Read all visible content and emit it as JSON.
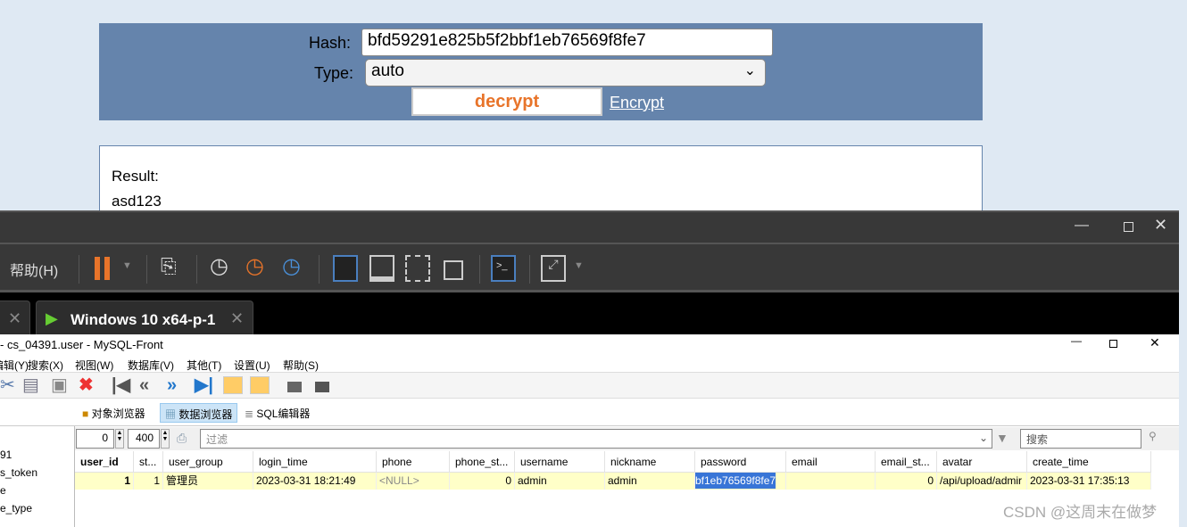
{
  "hash_form": {
    "hash_label": "Hash:",
    "hash_value": "bfd59291e825b5f2bbf1eb76569f8fe7",
    "type_label": "Type:",
    "type_value": "auto",
    "decrypt_label": "decrypt",
    "encrypt_label": "Encrypt"
  },
  "result": {
    "label": "Result:",
    "value": "asd123"
  },
  "vmware": {
    "menu_help": "帮助(H)",
    "tab_title": "Windows 10 x64-p-1"
  },
  "mysqlfront": {
    "title": "- cs_04391.user - MySQL-Front",
    "menu": [
      "编辑(Y)",
      "搜索(X)",
      "视图(W)",
      "数据库(V)",
      "其他(T)",
      "设置(U)",
      "帮助(S)"
    ],
    "view_tabs": [
      "对象浏览器",
      "数据浏览器",
      "SQL编辑器"
    ],
    "offset": "0",
    "limit": "400",
    "filter_placeholder": "过滤",
    "search_placeholder": "搜索",
    "tree": [
      "91",
      "s_token",
      "e",
      "e_type"
    ],
    "columns": [
      "user_id",
      "st...",
      "user_group",
      "login_time",
      "phone",
      "phone_st...",
      "username",
      "nickname",
      "password",
      "email",
      "email_st...",
      "avatar",
      "create_time"
    ],
    "row": [
      "1",
      "1",
      "管理员",
      "2023-03-31 18:21:49",
      "<NULL>",
      "0",
      "admin",
      "admin",
      "bf1eb76569f8fe7",
      "",
      "0",
      "/api/upload/admir",
      "2023-03-31 17:35:13"
    ]
  },
  "watermark": "CSDN @这周末在做梦"
}
